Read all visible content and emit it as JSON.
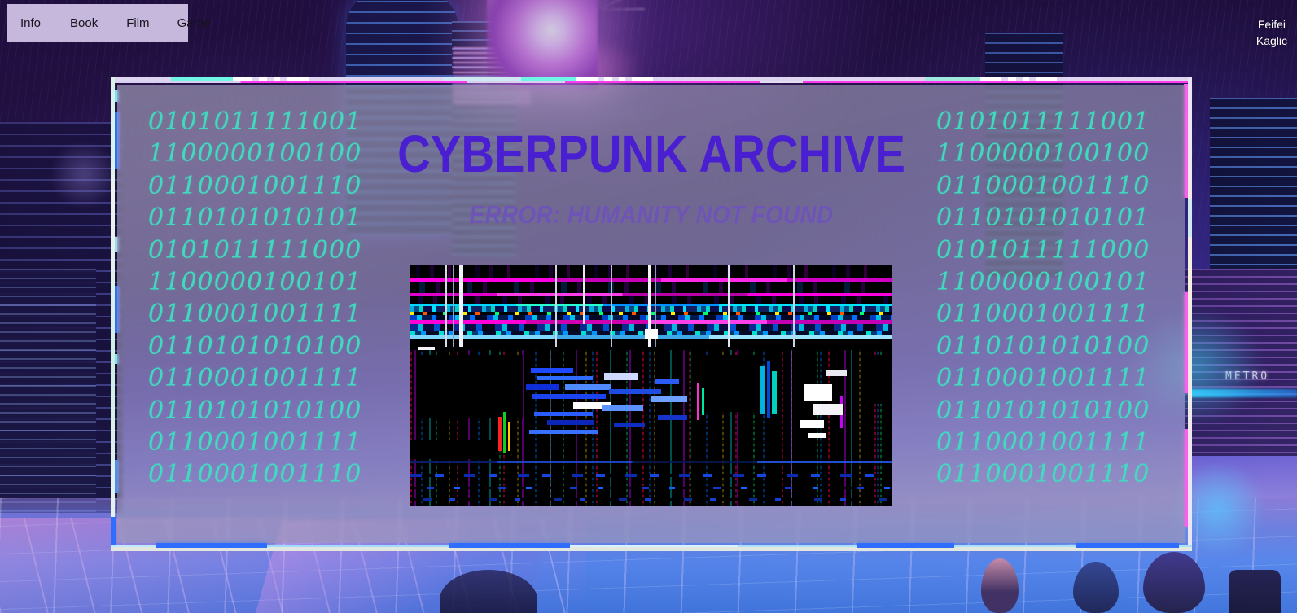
{
  "nav": {
    "items": [
      {
        "label": "Info"
      },
      {
        "label": "Book"
      },
      {
        "label": "Film"
      },
      {
        "label": "Game"
      }
    ]
  },
  "signature": {
    "first_name": "Feifei",
    "last_name": "Kaglic"
  },
  "hero": {
    "title": "CYBERPUNK ARCHIVE",
    "subtitle": "ERROR: HUMANITY NOT FOUND"
  },
  "background": {
    "metro_sign": "METRO"
  },
  "binary_stream": {
    "lines": [
      "0101011111001",
      "1100000100100",
      "0110001001110",
      "0110101010101",
      "0101011111000",
      "1100000100101",
      "0110001001111",
      "0110101010100",
      "0110001001111",
      "0110101010100",
      "0110001001111",
      "0110001001110"
    ]
  },
  "glitch_image": {
    "alt": "corrupted-datamosh-image"
  },
  "colors": {
    "nav_background": "#c6b8dc",
    "title_violet": "#4a1fd2",
    "subtitle_violet": "#6f54b8",
    "binary_cyan": "#3fe0c0",
    "border_magenta": "#ff3df0",
    "border_cyan": "#6ff6e6",
    "border_blue": "#2f6dff",
    "panel_glass": "rgba(150,146,178,0.62)"
  }
}
